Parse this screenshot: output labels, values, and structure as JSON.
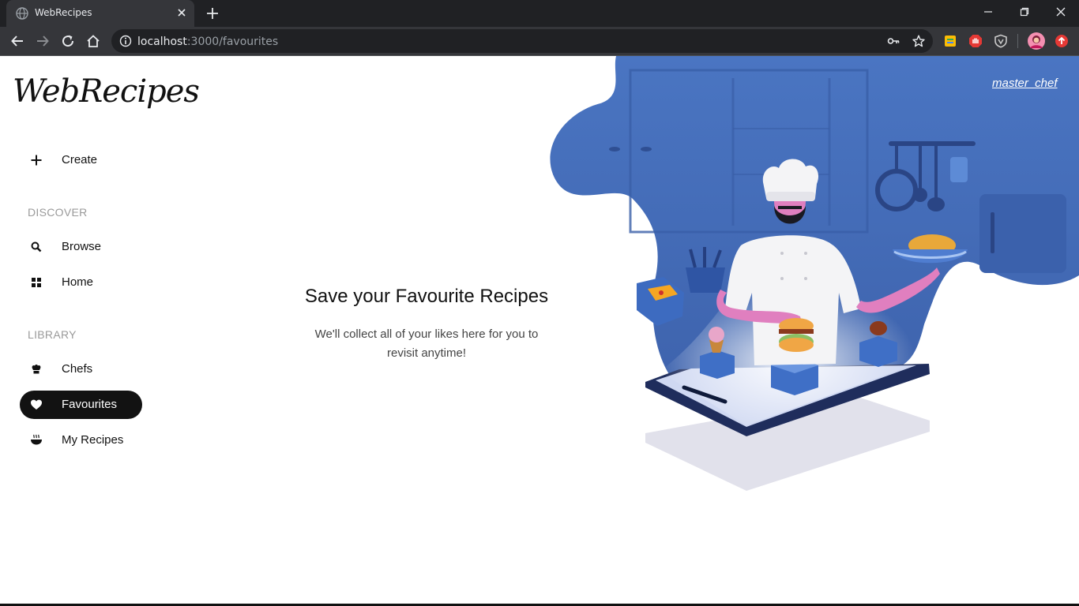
{
  "browser": {
    "tab_title": "WebRecipes",
    "url_host": "localhost",
    "url_path": ":3000/favourites"
  },
  "app": {
    "logo_text": "WebRecipes",
    "user_name": "master_chef"
  },
  "sidebar": {
    "create_label": "Create",
    "discover_heading": "DISCOVER",
    "browse_label": "Browse",
    "home_label": "Home",
    "library_heading": "LIBRARY",
    "chefs_label": "Chefs",
    "favourites_label": "Favourites",
    "my_recipes_label": "My Recipes",
    "active_item": "Favourites"
  },
  "main": {
    "empty_title": "Save your Favourite Recipes",
    "empty_subtitle": "We'll collect all of your likes here for you to revisit anytime!"
  },
  "colors": {
    "accent": "#121212",
    "illustration_blue": "#4a73bd",
    "chrome_dark": "#202124",
    "chrome_toolbar": "#35363a"
  },
  "icons": {
    "create": "plus-icon",
    "browse": "search-icon",
    "home": "grid-icon",
    "chefs": "chef-hat-icon",
    "favourites": "heart-icon",
    "my_recipes": "bowl-icon"
  }
}
